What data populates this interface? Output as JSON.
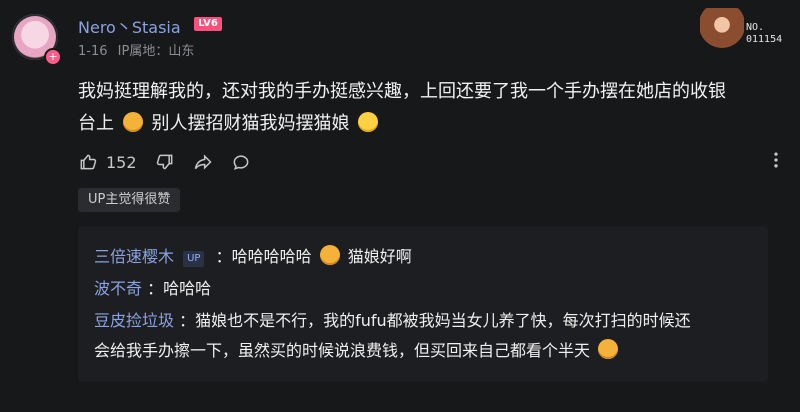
{
  "comment": {
    "username": "Nero丶Stasia",
    "level_badge": "LV6",
    "date": "1-16",
    "ip_label": "IP属地：山东",
    "text_line1": "我妈挺理解我的，还对我的手办挺感兴趣，上回还要了我一个手办摆在她店的收银",
    "text_line2_a": "台上",
    "text_line2_b": "别人摆招财猫我妈摆猫娘",
    "likes": "152",
    "tag": "UP主觉得很赞"
  },
  "decoration": {
    "id_label": "NO.\n011154"
  },
  "replies": [
    {
      "name": "三倍速樱木",
      "up": "UP",
      "prefix": "：哈哈哈哈哈",
      "suffix": "猫娘好啊"
    },
    {
      "name": "波不奇",
      "text": "：哈哈哈"
    },
    {
      "name": "豆皮捡垃圾",
      "text_line1": "：猫娘也不是不行，我的fufu都被我妈当女儿养了快，每次打扫的时候还",
      "text_line2": "会给我手办擦一下，虽然买的时候说浪费钱，但买回来自己都看个半天"
    }
  ]
}
